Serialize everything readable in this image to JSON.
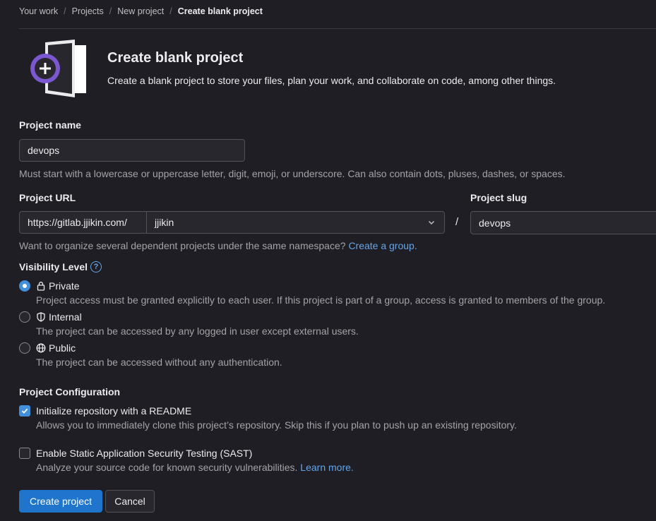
{
  "breadcrumb": [
    "Your work",
    "Projects",
    "New project",
    "Create blank project"
  ],
  "header": {
    "title": "Create blank project",
    "subtitle": "Create a blank project to store your files, plan your work, and collaborate on code, among other things."
  },
  "project_name": {
    "label": "Project name",
    "value": "devops",
    "help": "Must start with a lowercase or uppercase letter, digit, emoji, or underscore. Can also contain dots, pluses, dashes, or spaces."
  },
  "project_url": {
    "label": "Project URL",
    "prefix": "https://gitlab.jjikin.com/",
    "namespace": "jjikin",
    "separator": "/",
    "help_text": "Want to organize several dependent projects under the same namespace?",
    "help_link": "Create a group."
  },
  "project_slug": {
    "label": "Project slug",
    "value": "devops"
  },
  "visibility": {
    "label": "Visibility Level",
    "help_icon": "?",
    "options": [
      {
        "label": "Private",
        "icon": "lock-icon",
        "description": "Project access must be granted explicitly to each user. If this project is part of a group, access is granted to members of the group.",
        "selected": true
      },
      {
        "label": "Internal",
        "icon": "shield-icon",
        "description": "The project can be accessed by any logged in user except external users.",
        "selected": false
      },
      {
        "label": "Public",
        "icon": "globe-icon",
        "description": "The project can be accessed without any authentication.",
        "selected": false
      }
    ]
  },
  "configuration": {
    "label": "Project Configuration",
    "readme": {
      "label": "Initialize repository with a README",
      "description": "Allows you to immediately clone this project’s repository. Skip this if you plan to push up an existing repository.",
      "checked": true
    },
    "sast": {
      "label": "Enable Static Application Security Testing (SAST)",
      "description": "Analyze your source code for known security vulnerabilities.",
      "link": "Learn more.",
      "checked": false
    }
  },
  "actions": {
    "create": "Create project",
    "cancel": "Cancel"
  },
  "colors": {
    "background": "#1f1e24",
    "accent": "#1f75cb",
    "link": "#63a6e9",
    "illustration_purple": "#7b58cf"
  }
}
